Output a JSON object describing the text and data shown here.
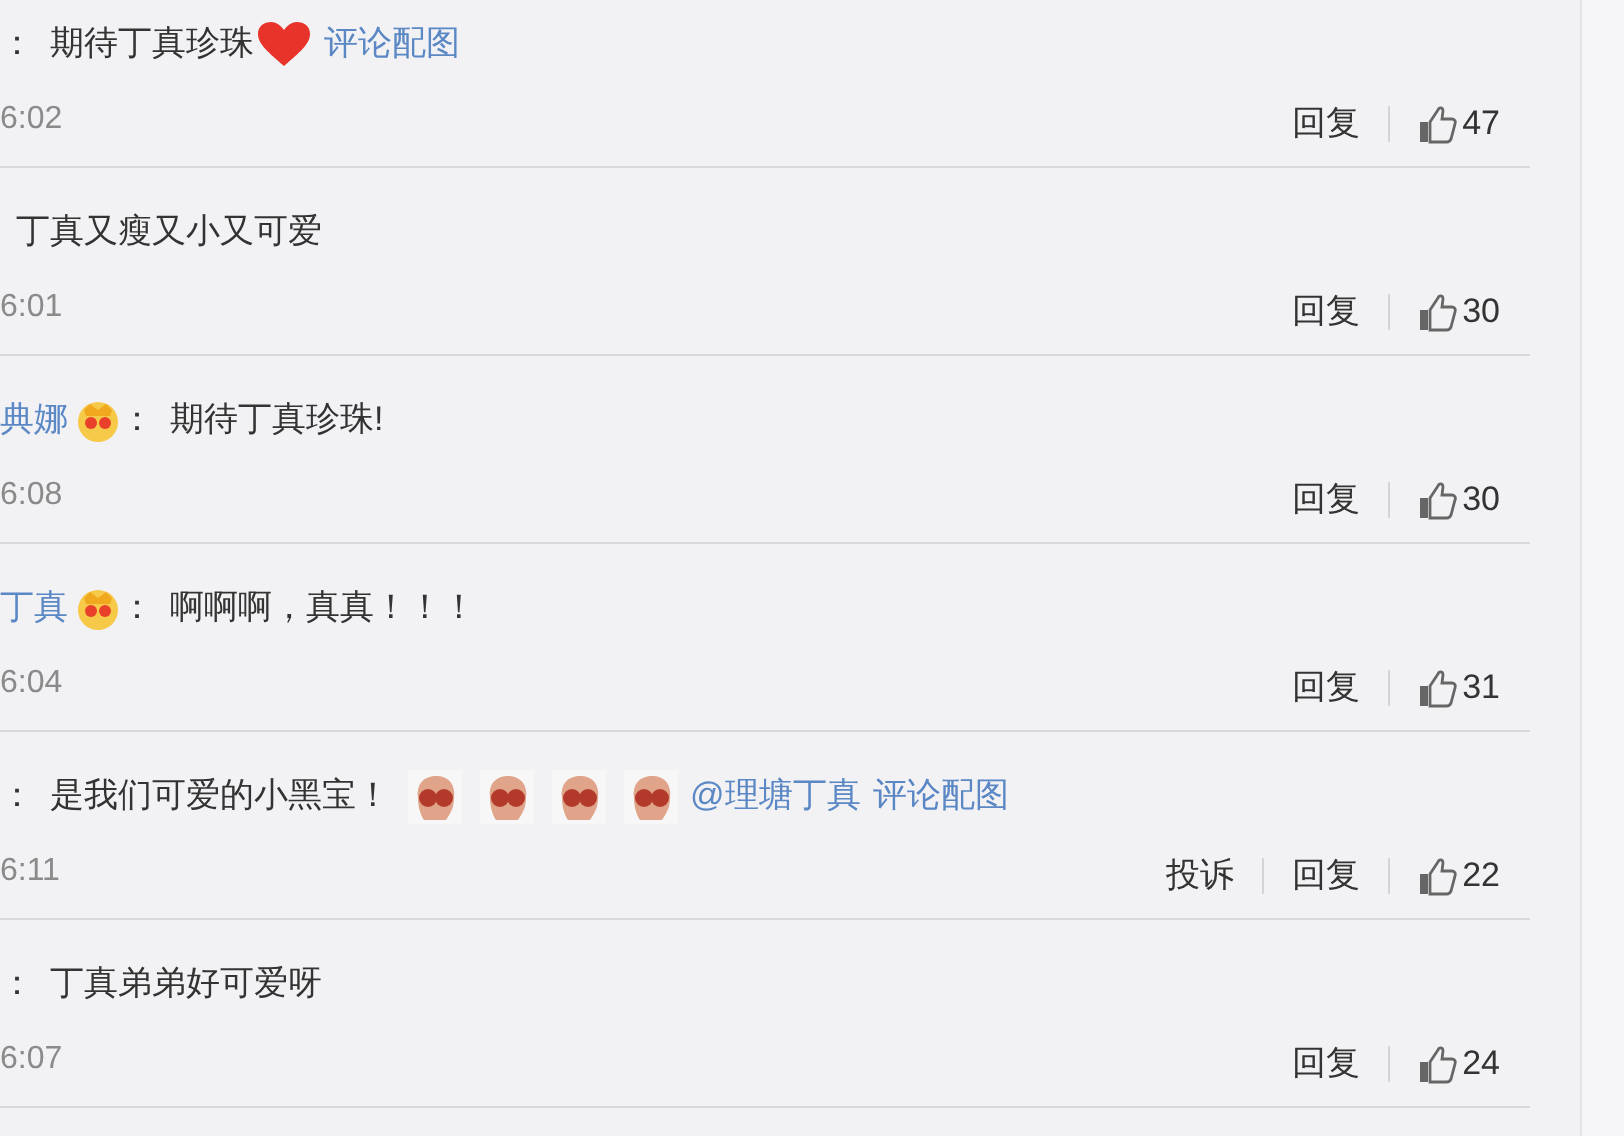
{
  "comments": [
    {
      "colon": "：",
      "body": [
        {
          "kind": "text",
          "text": "期待丁真珍珠"
        },
        {
          "kind": "heart"
        },
        {
          "kind": "link",
          "text": "评论配图"
        }
      ],
      "time": "6:02",
      "actions": [
        {
          "kind": "reply",
          "text": "回复"
        },
        {
          "kind": "like",
          "text": "47"
        }
      ]
    },
    {
      "body": [
        {
          "kind": "text",
          "text": "丁真又瘦又小又可爱"
        }
      ],
      "time": "6:01",
      "actions": [
        {
          "kind": "reply",
          "text": "回复"
        },
        {
          "kind": "like",
          "text": "30"
        }
      ]
    },
    {
      "colon": "：",
      "head": [
        {
          "kind": "name",
          "text": "典娜"
        },
        {
          "kind": "crown"
        }
      ],
      "body": [
        {
          "kind": "text",
          "text": "期待丁真珍珠!"
        }
      ],
      "time": "6:08",
      "actions": [
        {
          "kind": "reply",
          "text": "回复"
        },
        {
          "kind": "like",
          "text": "30"
        }
      ]
    },
    {
      "colon": "：",
      "head": [
        {
          "kind": "name",
          "text": "丁真"
        },
        {
          "kind": "crown"
        }
      ],
      "body": [
        {
          "kind": "text",
          "text": "啊啊啊，真真！！！"
        }
      ],
      "time": "6:04",
      "actions": [
        {
          "kind": "reply",
          "text": "回复"
        },
        {
          "kind": "like",
          "text": "31"
        }
      ]
    },
    {
      "colon": "：",
      "body": [
        {
          "kind": "text",
          "text": "是我们可爱的小黑宝！"
        },
        {
          "kind": "sticker"
        },
        {
          "kind": "sticker"
        },
        {
          "kind": "sticker"
        },
        {
          "kind": "sticker"
        },
        {
          "kind": "link",
          "text": "@理塘丁真"
        },
        {
          "kind": "link",
          "text": "评论配图"
        }
      ],
      "time": "6:11",
      "actions": [
        {
          "kind": "complain",
          "text": "投诉"
        },
        {
          "kind": "reply",
          "text": "回复"
        },
        {
          "kind": "like",
          "text": "22"
        }
      ]
    },
    {
      "colon": "：",
      "body": [
        {
          "kind": "text",
          "text": "丁真弟弟好可爱呀"
        }
      ],
      "time": "6:07",
      "actions": [
        {
          "kind": "reply",
          "text": "回复"
        },
        {
          "kind": "like",
          "text": "24"
        }
      ]
    }
  ]
}
